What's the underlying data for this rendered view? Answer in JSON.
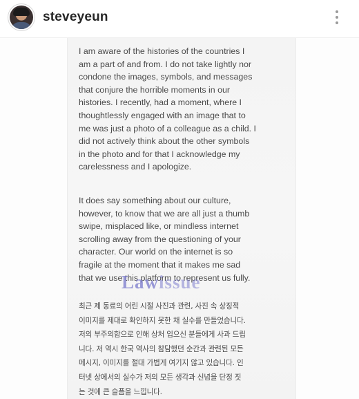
{
  "profile": {
    "username": "steveyeun",
    "avatar_icon": "profile-photo-avatar",
    "more_icon": "vertical-ellipsis-icon"
  },
  "statement": {
    "paragraph_1": "I am aware of the histories of the countries I\nam a part of and from.  I do not take lightly nor\ncondone the images, symbols, and messages\nthat conjure the horrible moments in our\nhistories.  I recently, had a moment, where I\nthoughtlessly engaged with an image that to\nme was just a photo of a colleague as a child.  I\ndid not actively think about the other symbols\nin the photo and for that I acknowledge my\ncarelessness and I apologize.",
    "paragraph_2": "It does say something about our culture,\nhowever, to know that we are all just a thumb\nswipe, misplaced like, or mindless internet\nscrolling away from the questioning of your\ncharacter.  Our world on the internet is so\nfragile at the moment that it makes me sad\nthat we use this platform to represent us fully.",
    "paragraph_korean": "최근 제 동료의 어린 시절 사진과 관련, 사진 속 상징적\n이미지를 제대로 확인하지 못한 채 실수를 만들었습니다.\n저의 부주의함으로 인해 상처 입으신 분들에게 사과 드립\n니다. 저 역시 한국 역사의 참담했던 순간과 관련된 모든\n메시지, 이미지를 절대 가볍게 여기지 않고 있습니다. 인\n터넷 상에서의 실수가 저의 모든 생각과 신념을 단정 짓\n는 것에 큰 슬픔을 느낍니다."
  },
  "watermark": {
    "part_1": "Law",
    "part_2": "issue",
    "color": "#7e7ecd"
  },
  "colors": {
    "paper": "#f4f4f4",
    "text": "#4a4a4a",
    "username": "#262626"
  }
}
